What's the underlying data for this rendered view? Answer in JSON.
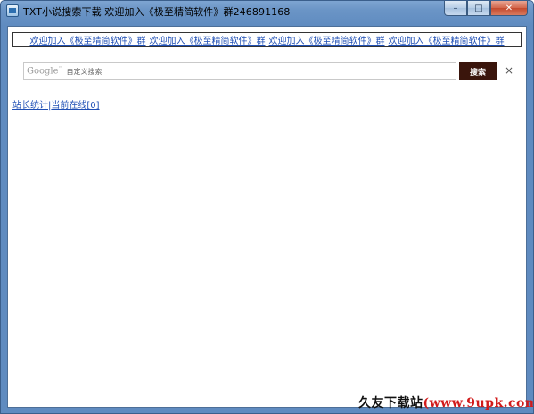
{
  "window": {
    "title": "TXT小说搜索下载   欢迎加入《极至精简软件》群246891168",
    "controls": {
      "minimize": "–",
      "maximize": "□",
      "close": "✕"
    }
  },
  "banner": {
    "links": [
      "欢迎加入《极至精简软件》群",
      "欢迎加入《极至精简软件》群",
      "欢迎加入《极至精简软件》群",
      "欢迎加入《极至精简软件》群"
    ]
  },
  "search": {
    "logo": "Google",
    "placeholder": "自定义搜索",
    "button": "搜索",
    "clear": "×"
  },
  "stats": {
    "site_stats": "站长统计",
    "separator": "|",
    "online_now": "当前在线[0]"
  },
  "watermark": {
    "text_main": "久友下载站",
    "text_url": "(www.9upk.com)"
  },
  "colors": {
    "link": "#1f4fb5",
    "search_button_bg": "#3a150c",
    "frame": "#5f8bc0"
  }
}
